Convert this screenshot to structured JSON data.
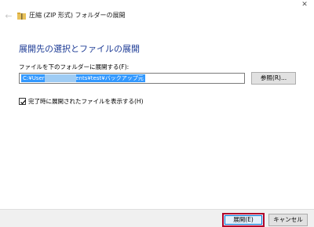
{
  "window": {
    "title": "圧縮 (ZIP 形式) フォルダーの展開",
    "back_glyph": "←",
    "close_glyph": "✕"
  },
  "dialog": {
    "heading": "展開先の選択とファイルの展開",
    "path_label": "ファイルを下のフォルダーに展開する(F):",
    "path_value": "C:¥Users¥        ¥Documents¥test¥バックアップ元",
    "browse_label": "参照(R)...",
    "show_files_checked": true,
    "show_files_label": "完了時に展開されたファイルを表示する(H)"
  },
  "footer": {
    "extract_label": "展開(E)",
    "cancel_label": "キャンセル"
  },
  "colors": {
    "heading": "#1e3c96",
    "selection": "#3399ff",
    "highlight_border": "#b0002a",
    "focus_border": "#0078d7"
  }
}
